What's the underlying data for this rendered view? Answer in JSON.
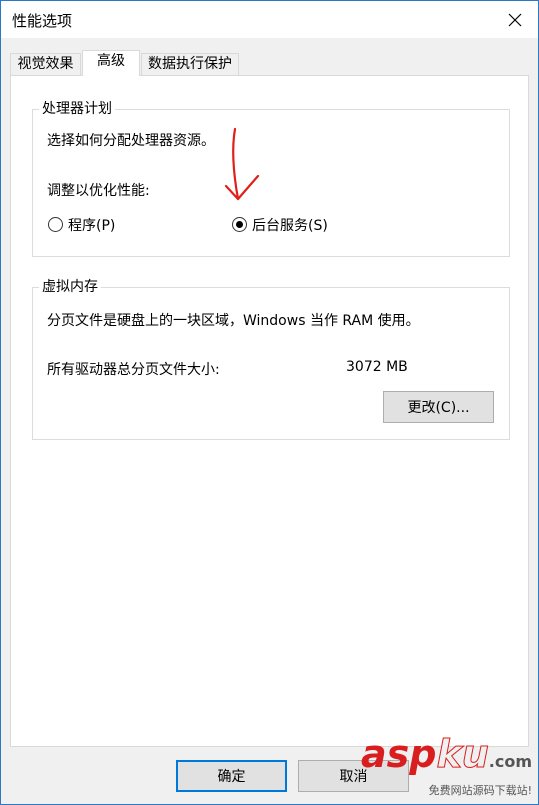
{
  "window": {
    "title": "性能选项"
  },
  "tabs": [
    {
      "label": "视觉效果"
    },
    {
      "label": "高级"
    },
    {
      "label": "数据执行保护"
    }
  ],
  "processor_group": {
    "legend": "处理器计划",
    "description": "选择如何分配处理器资源。",
    "adjust_label": "调整以优化性能:",
    "options": [
      {
        "label": "程序(P)",
        "selected": false
      },
      {
        "label": "后台服务(S)",
        "selected": true
      }
    ]
  },
  "virtual_memory_group": {
    "legend": "虚拟内存",
    "description": "分页文件是硬盘上的一块区域，Windows 当作 RAM 使用。",
    "total_label": "所有驱动器总分页文件大小:",
    "total_value": "3072 MB",
    "change_button": "更改(C)..."
  },
  "footer": {
    "ok_button": "确定",
    "cancel_button": "取消"
  },
  "watermark": {
    "logo_asp": "asp",
    "logo_ku": "ku",
    "logo_com": ".com",
    "subtitle": "免费网站源码下载站!"
  },
  "colors": {
    "accent": "#0078d7",
    "annotation": "#e0201a",
    "watermark": "#d81e1e"
  },
  "icons": {
    "close": "close-icon"
  }
}
